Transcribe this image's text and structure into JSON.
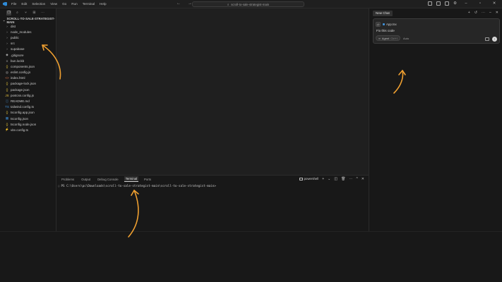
{
  "titlebar": {
    "menu": [
      "File",
      "Edit",
      "Selection",
      "View",
      "Go",
      "Run",
      "Terminal",
      "Help"
    ],
    "nav_back": "←",
    "nav_forward": "→",
    "search_text": "scroll-to-sale-strategist-main"
  },
  "sidebar": {
    "workspace": "SCROLL-TO-SALE-STRATEGIST-MAIN",
    "items": [
      {
        "label": "dist",
        "icon": "chevron-right-icon",
        "glyph": "›",
        "kind": "folder"
      },
      {
        "label": "node_modules",
        "icon": "chevron-right-icon",
        "glyph": "›",
        "kind": "folder"
      },
      {
        "label": "public",
        "icon": "chevron-right-icon",
        "glyph": "›",
        "kind": "folder"
      },
      {
        "label": "src",
        "icon": "chevron-right-icon",
        "glyph": "›",
        "kind": "folder"
      },
      {
        "label": "supabase",
        "icon": "chevron-right-icon",
        "glyph": "›",
        "kind": "folder"
      },
      {
        "label": ".gitignore",
        "icon": "git-icon",
        "glyph": "◆",
        "kind": "git"
      },
      {
        "label": "bun.lockb",
        "icon": "file-icon",
        "glyph": "≡",
        "kind": "gear"
      },
      {
        "label": "components.json",
        "icon": "json-icon",
        "glyph": "{}",
        "kind": "json"
      },
      {
        "label": "eslint.config.js",
        "icon": "eslint-icon",
        "glyph": "◎",
        "kind": "gear"
      },
      {
        "label": "index.html",
        "icon": "html-icon",
        "glyph": "<>",
        "kind": "html"
      },
      {
        "label": "package-lock.json",
        "icon": "json-icon",
        "glyph": "{}",
        "kind": "json"
      },
      {
        "label": "package.json",
        "icon": "json-icon",
        "glyph": "{}",
        "kind": "json"
      },
      {
        "label": "postcss.config.js",
        "icon": "js-icon",
        "glyph": "JS",
        "kind": "js"
      },
      {
        "label": "README.md",
        "icon": "info-icon",
        "glyph": "ⓘ",
        "kind": "md"
      },
      {
        "label": "tailwind.config.ts",
        "icon": "ts-icon",
        "glyph": "TS",
        "kind": "ts"
      },
      {
        "label": "tsconfig.app.json",
        "icon": "json-icon",
        "glyph": "{}",
        "kind": "json"
      },
      {
        "label": "tsconfig.json",
        "icon": "tsconfig-icon",
        "glyph": "▦",
        "kind": "ts"
      },
      {
        "label": "tsconfig.node.json",
        "icon": "json-icon",
        "glyph": "{}",
        "kind": "json"
      },
      {
        "label": "vite.config.ts",
        "icon": "vite-icon",
        "glyph": "⚡",
        "kind": "js"
      }
    ]
  },
  "chat": {
    "tab": "New Chat",
    "context_file": "App.tsx",
    "message": "Fix this code",
    "mode": "Agent",
    "mode_shortcut": "Ctrl+I",
    "model": "Auto"
  },
  "panel": {
    "tabs": [
      "Problems",
      "Output",
      "Debug Console",
      "Terminal",
      "Ports"
    ],
    "active_tab": "Terminal",
    "shell": "powershell",
    "prompt": "PS C:\\Users\\pc\\Downloads\\scroll-to-sale-strategist-main\\scroll-to-sale-strategist-main>"
  },
  "colors": {
    "background": "#181818",
    "editor": "#1f1f1f",
    "annotation": "#f0a030"
  }
}
